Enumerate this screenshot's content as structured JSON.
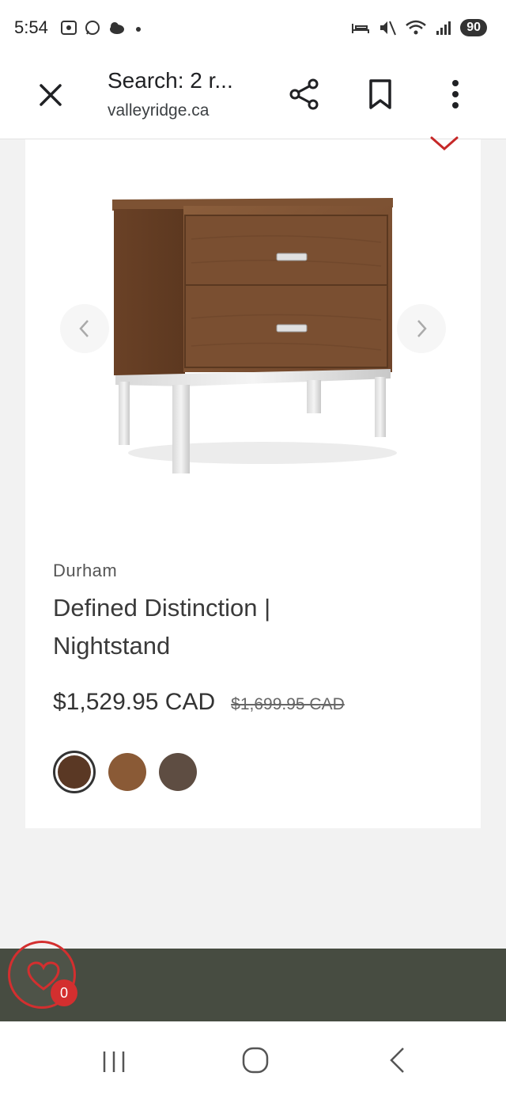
{
  "status_bar": {
    "time": "5:54",
    "battery": "90"
  },
  "toolbar": {
    "title": "Search: 2 r...",
    "url": "valleyridge.ca"
  },
  "product": {
    "brand": "Durham",
    "name": "Defined Distinction | Nightstand",
    "price": "$1,529.95 CAD",
    "original_price": "$1,699.95 CAD",
    "swatches": [
      {
        "color": "#5a3824",
        "selected": true
      },
      {
        "color": "#8a5a36",
        "selected": false
      },
      {
        "color": "#5e4d42",
        "selected": false
      }
    ]
  },
  "wishlist": {
    "count": "0"
  },
  "colors": {
    "accent": "#d32f2f",
    "footer": "#474c41"
  }
}
